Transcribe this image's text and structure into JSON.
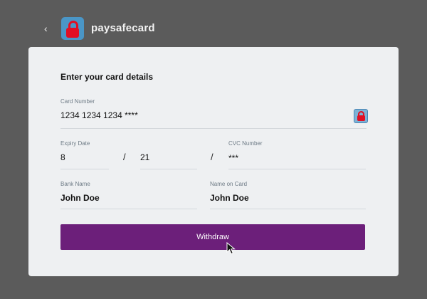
{
  "header": {
    "back_glyph": "‹",
    "brand": "paysafecard"
  },
  "form": {
    "title": "Enter your card details",
    "card_number": {
      "label": "Card Number",
      "value": "1234 1234 1234 ****"
    },
    "expiry": {
      "label": "Expiry Date",
      "month": "8",
      "year": "21",
      "separator": "/"
    },
    "cvc": {
      "label": "CVC Number",
      "value": "***",
      "separator": "/"
    },
    "bank_name": {
      "label": "Bank Name",
      "value": "John Doe"
    },
    "name_on_card": {
      "label": "Name on Card",
      "value": "John Doe"
    },
    "submit_label": "Withdraw"
  },
  "colors": {
    "background": "#5b5b5b",
    "card": "#eef0f2",
    "button": "#6c1f7a",
    "logo_blue": "#4a96c7",
    "logo_red": "#e10f23"
  },
  "icons": [
    "back-chevron-icon",
    "paysafecard-lock-icon",
    "card-lock-icon",
    "mouse-cursor-icon"
  ]
}
